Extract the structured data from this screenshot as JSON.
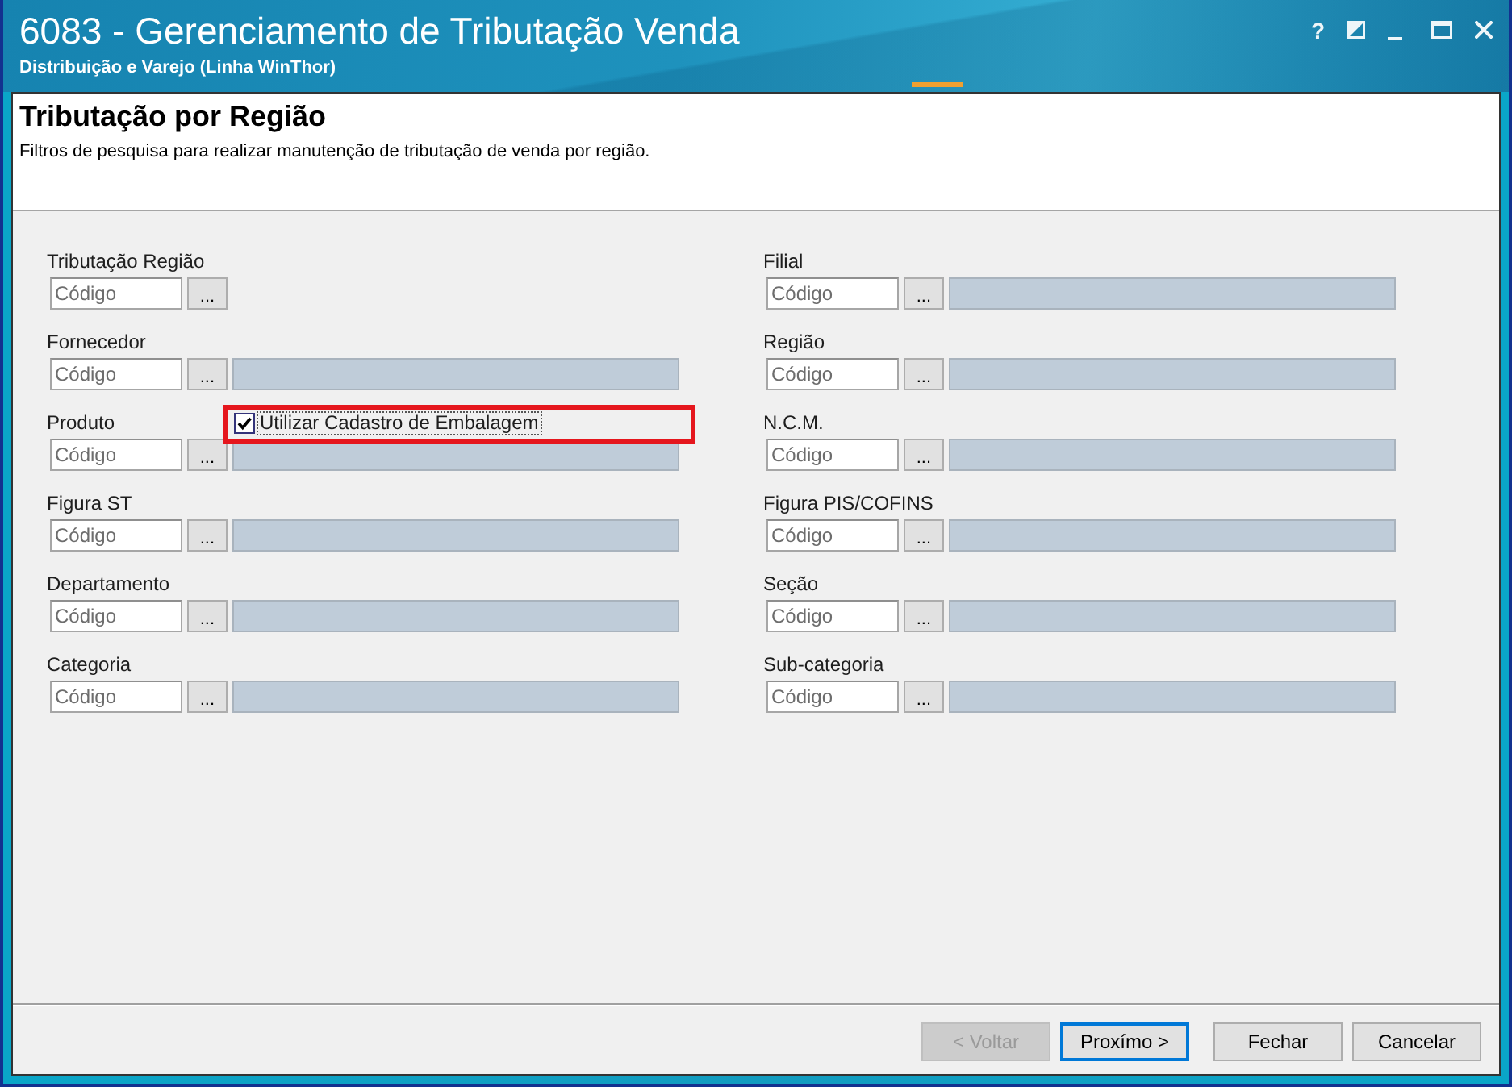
{
  "window": {
    "title": "6083 - Gerenciamento de Tributação Venda",
    "subtitle": "Distribuição e Varejo (Linha WinThor)",
    "help_button": "?"
  },
  "header": {
    "title": "Tributação por Região",
    "description": "Filtros de pesquisa para realizar manutenção de tributação de venda por região."
  },
  "filters": {
    "left": [
      {
        "kind": "code",
        "label": "Tributação Região",
        "placeholder": "Código",
        "lookup": "..."
      },
      {
        "kind": "code_description",
        "label": "Fornecedor",
        "placeholder": "Código",
        "lookup": "...",
        "readonly": true
      },
      {
        "kind": "code_description",
        "label": "Produto",
        "placeholder": "Código",
        "lookup": "...",
        "readonly": true,
        "checkbox": {
          "label": "Utilizar Cadastro de Embalagem",
          "checked": true,
          "focused": true,
          "highlighted": true
        }
      },
      {
        "kind": "code_description",
        "label": "Figura ST",
        "placeholder": "Código",
        "lookup": "...",
        "readonly": true
      },
      {
        "kind": "code_description",
        "label": "Departamento",
        "placeholder": "Código",
        "lookup": "...",
        "readonly": true
      },
      {
        "kind": "code_description",
        "label": "Categoria",
        "placeholder": "Código",
        "lookup": "...",
        "readonly": true
      }
    ],
    "right": [
      {
        "kind": "code_description",
        "label": "Filial",
        "placeholder": "Código",
        "lookup": "...",
        "readonly": true
      },
      {
        "kind": "code_description",
        "label": "Região",
        "placeholder": "Código",
        "lookup": "...",
        "readonly": true
      },
      {
        "kind": "code_description",
        "label": "N.C.M.",
        "placeholder": "Código",
        "lookup": "...",
        "readonly": true
      },
      {
        "kind": "code_description",
        "label": "Figura PIS/COFINS",
        "placeholder": "Código",
        "lookup": "...",
        "readonly": true
      },
      {
        "kind": "code_description",
        "label": "Seção",
        "placeholder": "Código",
        "lookup": "...",
        "readonly": true
      },
      {
        "kind": "code_description",
        "label": "Sub-categoria",
        "placeholder": "Código",
        "lookup": "...",
        "readonly": true
      }
    ]
  },
  "footer": {
    "navigation_buttons": [
      {
        "label": "< Voltar",
        "disabled": true,
        "default": false
      },
      {
        "label": "Proxímo >",
        "disabled": false,
        "default": true
      }
    ],
    "dialog_buttons": [
      {
        "label": "Fechar",
        "disabled": false,
        "default": false
      },
      {
        "label": "Cancelar",
        "disabled": false,
        "default": false
      }
    ]
  }
}
